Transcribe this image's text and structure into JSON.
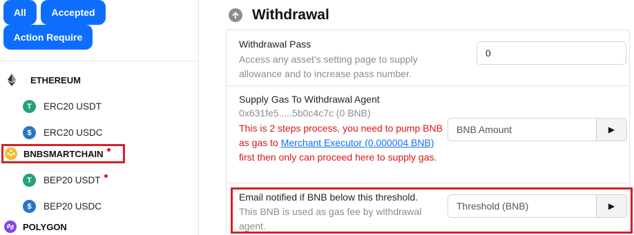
{
  "filters": {
    "all": "All",
    "accepted": "Accepted",
    "action_required": "Action Require"
  },
  "chains": {
    "ethereum": {
      "name": "ETHEREUM",
      "tokens": [
        {
          "label": "ERC20 USDT",
          "icon": "tether-icon"
        },
        {
          "label": "ERC20 USDC",
          "icon": "usdc-icon"
        }
      ]
    },
    "bnb": {
      "name": "BNBSMARTCHAIN",
      "tokens": [
        {
          "label": "BEP20 USDT",
          "icon": "tether-icon"
        },
        {
          "label": "BEP20 USDC",
          "icon": "usdc-icon"
        }
      ]
    },
    "polygon": {
      "name": "POLYGON"
    }
  },
  "withdrawal": {
    "title": "Withdrawal",
    "pass": {
      "label": "Withdrawal Pass",
      "desc_line1": "Access any asset's setting page to supply",
      "desc_line2": "allowance and to increase pass number.",
      "value": "0"
    },
    "gas": {
      "label": "Supply Gas To Withdrawal Agent",
      "address": "0x631fe5.....5b0c4c7c (0 BNB)",
      "warn_a": "This is 2 steps process, you need to pump BNB as gas to ",
      "link": "Merchant Executor (0.000004 BNB)",
      "warn_b": " first then only can proceed here to supply gas.",
      "placeholder": "BNB Amount"
    },
    "threshold": {
      "label": "Email notified if BNB below this threshold.",
      "desc_line1": "This BNB is used as gas fee by withdrawal",
      "desc_line2": "agent.",
      "placeholder": "Threshold (BNB)"
    }
  },
  "colors": {
    "primary": "#0d6efd",
    "alert": "#dc1414",
    "highlight": "#d61f26",
    "tether": "#26a17b",
    "usdc": "#2775ca",
    "bnb": "#f3ba2f",
    "polygon": "#8247e5"
  }
}
